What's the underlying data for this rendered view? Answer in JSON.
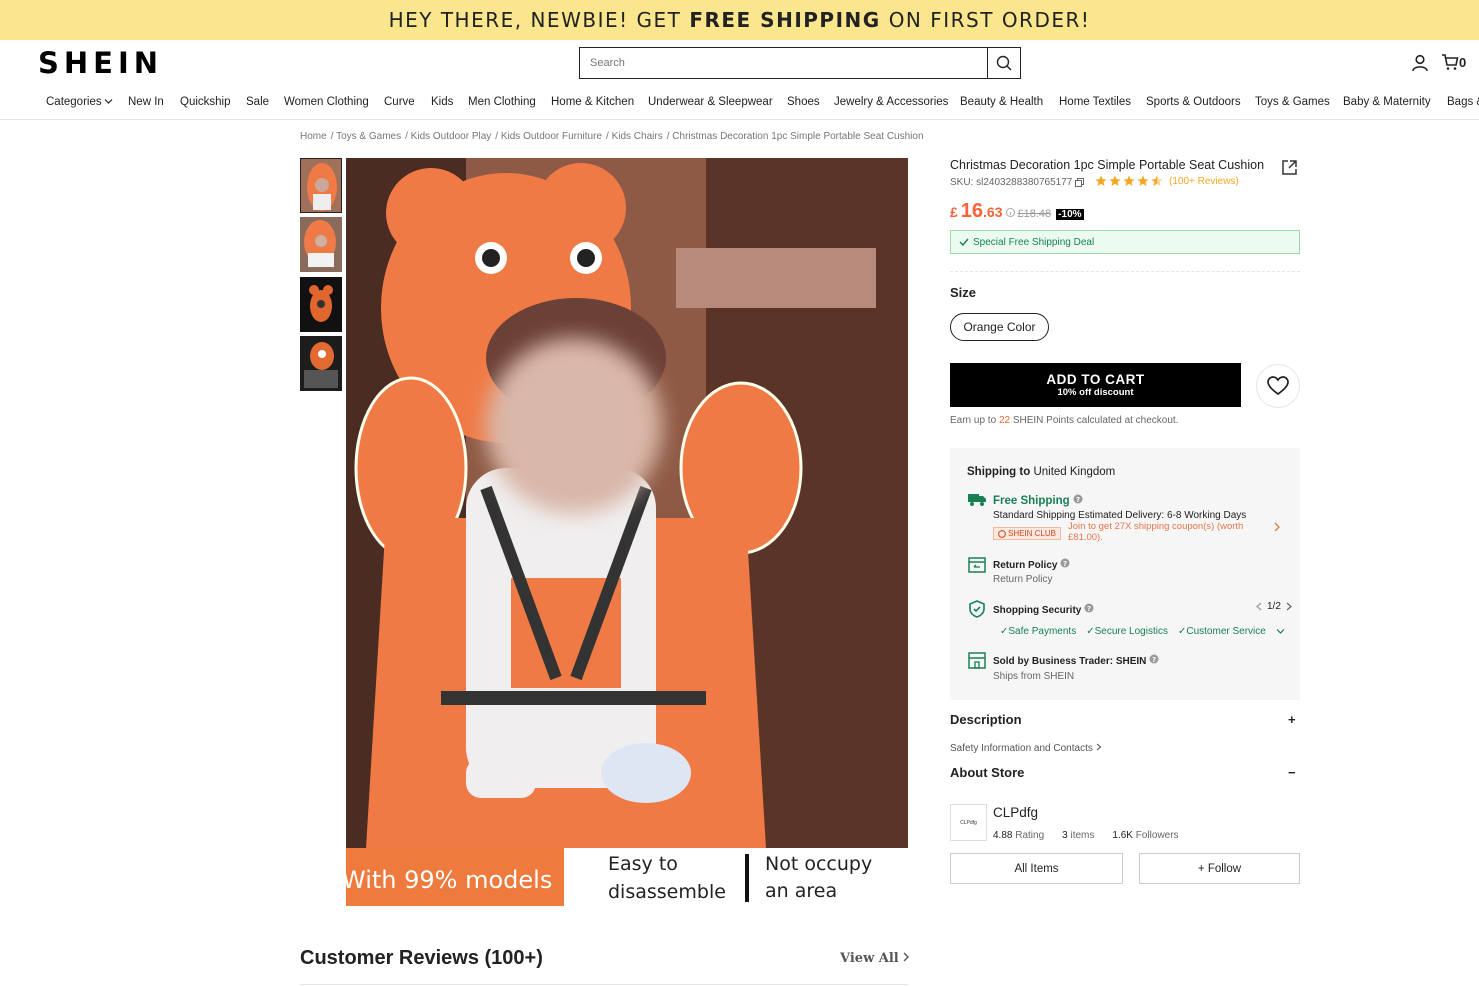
{
  "promo": {
    "pre": "HEY THERE, NEWBIE! GET",
    "bold": "FREE SHIPPING",
    "post": "ON FIRST ORDER!"
  },
  "logo": "SHEIN",
  "search": {
    "placeholder": "Search"
  },
  "cart": {
    "count": "0"
  },
  "nav": [
    "Categories",
    "New In",
    "Quickship",
    "Sale",
    "Women Clothing",
    "Curve",
    "Kids",
    "Men Clothing",
    "Home & Kitchen",
    "Underwear & Sleepwear",
    "Shoes",
    "Jewelry & Accessories",
    "Beauty & Health",
    "Home Textiles",
    "Sports & Outdoors",
    "Toys & Games",
    "Baby & Maternity",
    "Bags &"
  ],
  "breadcrumb": [
    "Home",
    "Toys & Games",
    "Kids Outdoor Play",
    "Kids Outdoor Furniture",
    "Kids Chairs",
    "Christmas Decoration 1pc Simple Portable Seat Cushion"
  ],
  "product": {
    "title": "Christmas Decoration 1pc Simple Portable Seat Cushion",
    "sku": "SKU: sl2403288380765177",
    "reviews_link": "(100+ Reviews)",
    "rating_stars": 4.5,
    "price_currency": "£",
    "price_int": "16",
    "price_dec": ".63",
    "price_old": "£18.48",
    "discount": "-10%",
    "shipping_deal": "Special Free Shipping Deal",
    "size_label": "Size",
    "size_option": "Orange Color",
    "add_to_cart": "ADD TO CART",
    "add_to_cart_sub": "10% off discount",
    "points_pre": "Earn up to",
    "points_num": "22",
    "points_post": "SHEIN Points calculated at checkout."
  },
  "image_overlay": {
    "left": "With 99% models",
    "mid1": "Easy to",
    "mid2": "disassemble",
    "right1": "Not occupy",
    "right2": "an area"
  },
  "shipping": {
    "to_label": "Shipping to",
    "to_country": "United Kingdom",
    "free_title": "Free Shipping",
    "free_desc": "Standard Shipping Estimated Delivery: 6-8 Working Days",
    "club_badge": "SHEIN CLUB",
    "club_text1": "Join to get 27X shipping coupon(s) (worth",
    "club_text2": "£81.00).",
    "return_title": "Return Policy",
    "return_sub": "Return Policy",
    "security_title": "Shopping Security",
    "security_pager": "1/2",
    "security_items": [
      "Safe Payments",
      "Secure Logistics",
      "Customer Service"
    ],
    "seller_title": "Sold by Business Trader: SHEIN",
    "seller_sub": "Ships from SHEIN"
  },
  "description": {
    "title": "Description",
    "toggle": "+",
    "safety_link": "Safety Information and Contacts"
  },
  "store": {
    "title": "About Store",
    "toggle": "−",
    "logo_text": "CLPdfg",
    "name": "CLPdfg",
    "rating_val": "4.88",
    "rating_label": "Rating",
    "items_val": "3",
    "items_label": "items",
    "followers_val": "1.6K",
    "followers_label": "Followers",
    "all_items": "All Items",
    "follow": "+ Follow"
  },
  "reviews": {
    "title": "Customer Reviews (100+)",
    "view_all": "View All"
  },
  "colors": {
    "accent": "#fa6338",
    "promo_bg": "#fae78d",
    "green": "#198055",
    "star": "#f5a623"
  }
}
